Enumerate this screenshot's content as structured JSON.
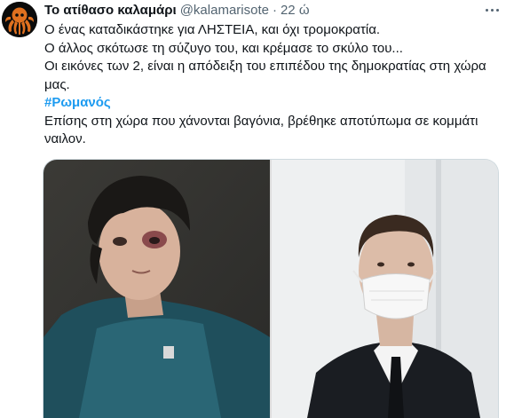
{
  "tweet": {
    "display_name": "Το ατίθασο καλαμάρι",
    "handle": "@kalamarisote",
    "separator": "·",
    "time": "22 ώ",
    "lines": [
      "Ο ένας καταδικάστηκε για ΛΗΣΤΕΙΑ, και όχι τρομοκρατία.",
      "Ο άλλος σκότωσε τη σύζυγο του, και κρέμασε το σκύλο του...",
      "Οι εικόνες των 2, είναι η απόδειξη του επιπέδου της δημοκρατίας στη χώρα",
      "μας."
    ],
    "hashtag": "#Ρωμανός",
    "lines_after": [
      "Επίσης στη χώρα που χάνονται βαγόνια, βρέθηκε αποτύπωμα σε κομμάτι",
      "ναιλον."
    ]
  },
  "icons": {
    "avatar": "kraken-avatar-icon",
    "more": "more-options-icon"
  },
  "colors": {
    "link": "#1d9bf0",
    "secondary_text": "#536471",
    "primary_text": "#0f1419",
    "border": "#cfd9de"
  }
}
